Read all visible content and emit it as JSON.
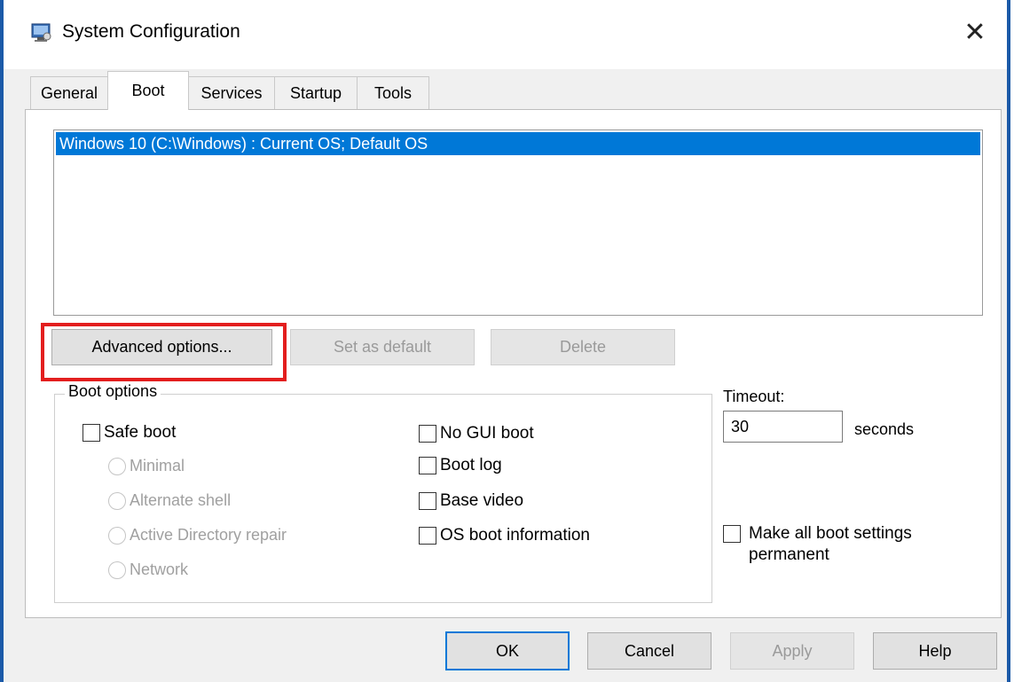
{
  "window": {
    "title": "System Configuration",
    "close_glyph": "✕"
  },
  "tabs": [
    {
      "label": "General",
      "active": false
    },
    {
      "label": "Boot",
      "active": true
    },
    {
      "label": "Services",
      "active": false
    },
    {
      "label": "Startup",
      "active": false
    },
    {
      "label": "Tools",
      "active": false
    }
  ],
  "os_list": {
    "items": [
      "Windows 10 (C:\\Windows) : Current OS; Default OS"
    ],
    "selected_index": 0
  },
  "buttons": {
    "advanced": "Advanced options...",
    "set_default": "Set as default",
    "delete": "Delete"
  },
  "boot_options": {
    "label": "Boot options",
    "safe_boot": "Safe boot",
    "radios": [
      "Minimal",
      "Alternate shell",
      "Active Directory repair",
      "Network"
    ],
    "right_checks": [
      "No GUI boot",
      "Boot log",
      "Base video",
      "OS boot information"
    ]
  },
  "timeout": {
    "label": "Timeout:",
    "value": "30",
    "unit": "seconds"
  },
  "permanent": {
    "line1": "Make all boot settings",
    "line2": "permanent"
  },
  "footer": {
    "ok": "OK",
    "cancel": "Cancel",
    "apply": "Apply",
    "help": "Help"
  },
  "colors": {
    "selection": "#0078d7",
    "highlight_box": "#e31e1e",
    "window_border": "#1b5aa8"
  },
  "icons": {
    "app": "system-configuration-icon",
    "close": "close-icon"
  }
}
